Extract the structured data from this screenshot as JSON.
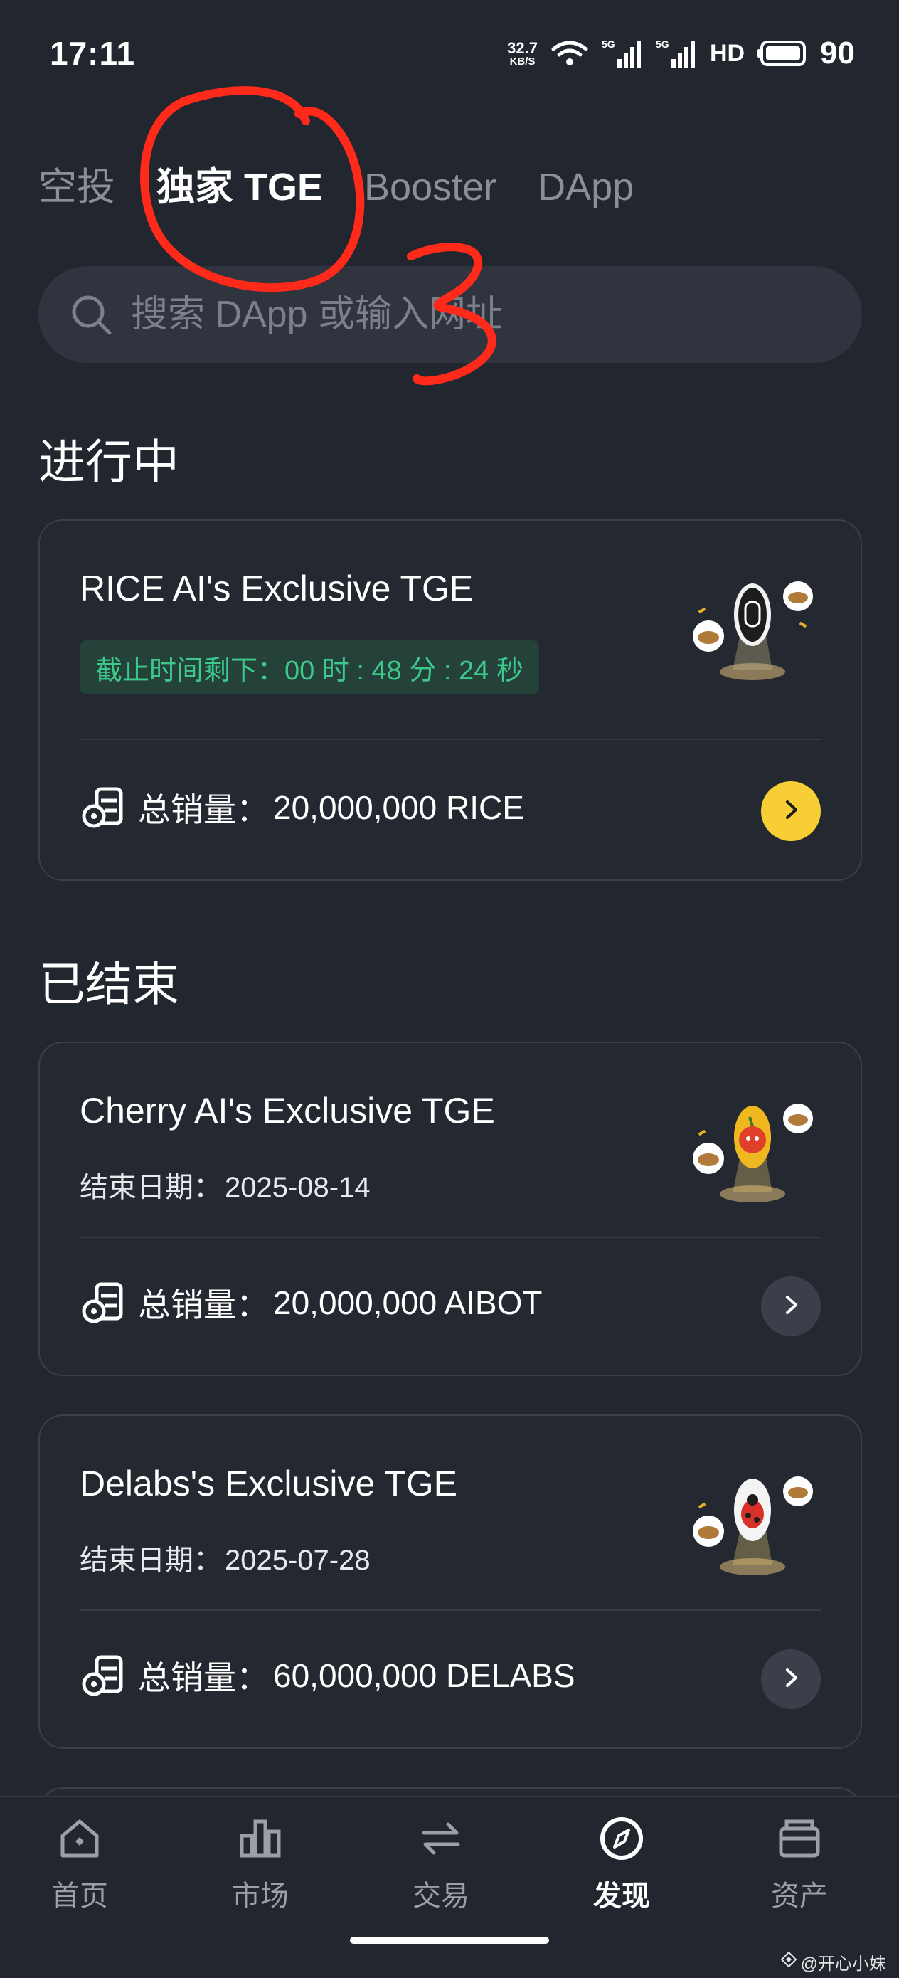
{
  "status_bar": {
    "time": "17:11",
    "network_speed": "32.7",
    "network_speed_unit": "KB/S",
    "hd_label": "HD",
    "battery": "90"
  },
  "tabs": [
    {
      "label": "空投",
      "active": false
    },
    {
      "label": "独家 TGE",
      "active": true
    },
    {
      "label": "Booster",
      "active": false
    },
    {
      "label": "DApp",
      "active": false
    }
  ],
  "search": {
    "placeholder": "搜索 DApp 或输入网址"
  },
  "ongoing": {
    "title": "进行中",
    "cards": [
      {
        "title": "RICE AI's Exclusive TGE",
        "countdown": "截止时间剩下：00 时 : 48 分 : 24 秒",
        "supply_label": "总销量：",
        "supply_value": "20,000,000 RICE",
        "button_style": "yellow"
      }
    ]
  },
  "ended": {
    "title": "已结束",
    "cards": [
      {
        "title": "Cherry AI's Exclusive TGE",
        "end_label": "结束日期：",
        "end_date": "2025-08-14",
        "supply_label": "总销量：",
        "supply_value": "20,000,000 AIBOT"
      },
      {
        "title": "Delabs's Exclusive TGE",
        "end_label": "结束日期：",
        "end_date": "2025-07-28",
        "supply_label": "总销量：",
        "supply_value": "60,000,000 DELABS"
      }
    ]
  },
  "bottom_nav": [
    {
      "label": "首页",
      "icon": "home-icon",
      "active": false
    },
    {
      "label": "市场",
      "icon": "market-icon",
      "active": false
    },
    {
      "label": "交易",
      "icon": "trade-icon",
      "active": false
    },
    {
      "label": "发现",
      "icon": "discover-icon",
      "active": true
    },
    {
      "label": "资产",
      "icon": "wallet-icon",
      "active": false
    }
  ],
  "watermark": "@开心小妹",
  "colors": {
    "background": "#22262e",
    "accent_yellow": "#f7cf35",
    "countdown_green": "#3dc88c",
    "annotation_red": "#ff2a1a"
  }
}
